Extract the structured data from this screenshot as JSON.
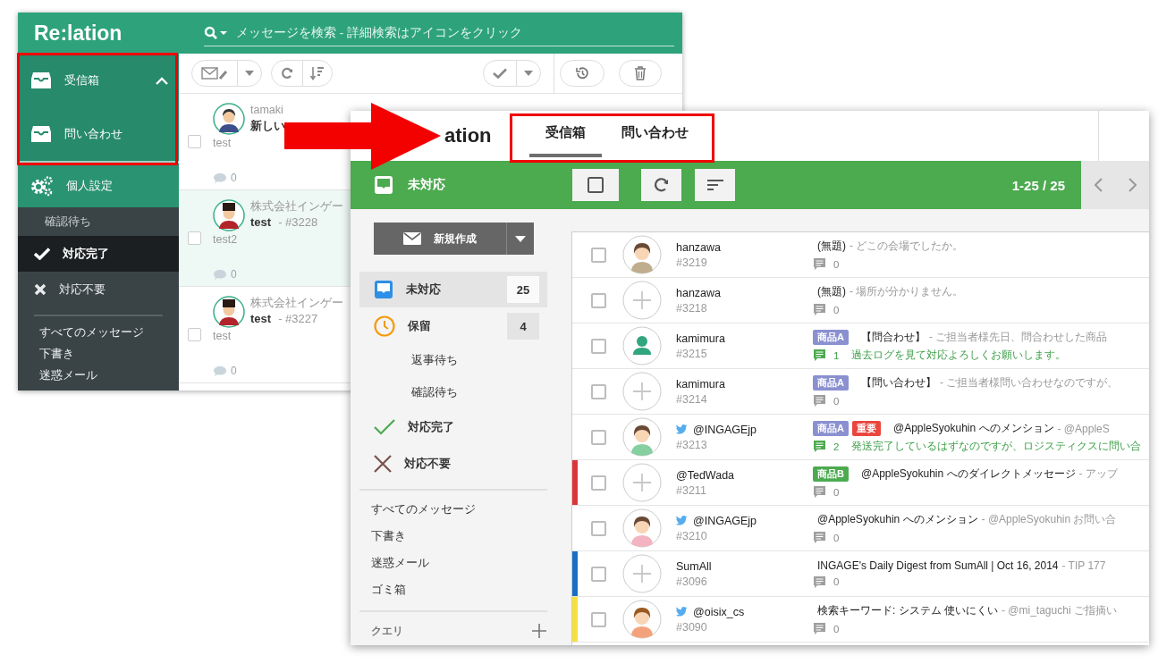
{
  "old_window": {
    "logo": "Re:lation",
    "search": {
      "placeholder": "メッセージを検索 - 詳細検索はアイコンをクリック"
    },
    "sidebar": {
      "inboxes": [
        {
          "label": "受信箱",
          "expanded": true
        },
        {
          "label": "問い合わせ"
        }
      ],
      "settings": "個人設定",
      "statuses": [
        {
          "label": "確認待ち",
          "kind": "sub",
          "selected": false
        },
        {
          "label": "対応完了",
          "kind": "done",
          "selected": true
        },
        {
          "label": "対応不要",
          "kind": "ignore",
          "selected": false
        }
      ],
      "folders": [
        "すべてのメッセージ",
        "下書き",
        "迷惑メール"
      ]
    },
    "messages": [
      {
        "sender": "tamaki",
        "subject": "新しい",
        "preview": "test",
        "comments": "0",
        "selected": false,
        "checked": false
      },
      {
        "sender": "株式会社インゲー",
        "subject": "test",
        "number": "- #3228",
        "preview": "test2",
        "comments": "0",
        "selected": true,
        "checked": false
      },
      {
        "sender": "株式会社インゲー",
        "subject": "test",
        "number": "- #3227",
        "preview": "test",
        "comments": "0",
        "selected": false,
        "checked": false
      }
    ]
  },
  "new_window": {
    "logo": "ation",
    "tabs": [
      {
        "label": "受信箱",
        "selected": true
      },
      {
        "label": "問い合わせ",
        "selected": false
      }
    ],
    "toolbar": {
      "title": "未対応",
      "range": "1-25 / 25",
      "select_all": {
        "checked": false
      }
    },
    "compose_button": "新規作成",
    "nav": [
      {
        "label": "未対応",
        "kind": "inbox",
        "count": "25",
        "selected": true
      },
      {
        "label": "保留",
        "kind": "hold",
        "count": "4",
        "selected": false
      },
      {
        "label": "返事待ち",
        "kind": "sub",
        "selected": false
      },
      {
        "label": "確認待ち",
        "kind": "sub",
        "selected": false
      },
      {
        "label": "対応完了",
        "kind": "done",
        "selected": false
      },
      {
        "label": "対応不要",
        "kind": "ignore",
        "selected": false
      }
    ],
    "folders": [
      "すべてのメッセージ",
      "下書き",
      "迷惑メール",
      "ゴミ箱"
    ],
    "query": "クエリ",
    "messages": [
      {
        "name": "hanzawa",
        "number": "#3219",
        "kind": "photo",
        "twitter": false,
        "checked": false,
        "subject": "(無題)",
        "preview": "- どこの会場でしたか。",
        "comments": "0"
      },
      {
        "name": "hanzawa",
        "number": "#3218",
        "kind": "add",
        "twitter": false,
        "checked": false,
        "subject": "(無題)",
        "preview": "- 場所が分かりません。",
        "comments": "0"
      },
      {
        "name": "kamimura",
        "number": "#3215",
        "kind": "user",
        "twitter": false,
        "checked": false,
        "tags": [
          {
            "label": "商品A",
            "color": "#8a90d0"
          }
        ],
        "subject": "【問合わせ】",
        "preview": "- ご担当者様先日、問合わせした商品",
        "comments": "1",
        "comment_text": "過去ログを見て対応よろしくお願いします。"
      },
      {
        "name": "kamimura",
        "number": "#3214",
        "kind": "add",
        "twitter": false,
        "checked": false,
        "tags": [
          {
            "label": "商品A",
            "color": "#8a90d0"
          }
        ],
        "subject": "【問い合わせ】",
        "preview": "- ご担当者様問い合わせなのですが、",
        "comments": "0"
      },
      {
        "name": "@INGAGEjp",
        "number": "#3213",
        "kind": "photo",
        "twitter": true,
        "checked": false,
        "tags": [
          {
            "label": "商品A",
            "color": "#8a90d0"
          },
          {
            "label": "重要",
            "color": "#e9463f"
          }
        ],
        "subject": "@AppleSyokuhin へのメンション",
        "preview": "- @AppleS",
        "comments": "2",
        "comment_text": "発送完了しているはずなのですが、ロジスティクスに問い合"
      },
      {
        "name": "@TedWada",
        "number": "#3211",
        "kind": "add",
        "twitter": false,
        "checked": false,
        "color": "#d9363a",
        "tags": [
          {
            "label": "商品B",
            "color": "#4caa4f"
          }
        ],
        "subject": "@AppleSyokuhin へのダイレクトメッセージ",
        "preview": "- アップ",
        "comments": "0"
      },
      {
        "name": "@INGAGEjp",
        "number": "#3210",
        "kind": "photo",
        "twitter": true,
        "checked": false,
        "subject": "@AppleSyokuhin へのメンション",
        "preview": "- @AppleSyokuhin お問い合",
        "comments": "0"
      },
      {
        "name": "SumAll",
        "number": "#3096",
        "kind": "add",
        "twitter": false,
        "checked": false,
        "color": "#1a6fc4",
        "subject": "INGAGE's Daily Digest from SumAll | Oct 16, 2014",
        "preview": "- TIP 177",
        "comments": "0"
      },
      {
        "name": "@oisix_cs",
        "number": "#3090",
        "kind": "photo",
        "twitter": true,
        "checked": false,
        "color": "#f7e03c",
        "subject": "検索キーワード: システム 使いにくい",
        "preview": "- @mi_taguchi ご指摘い",
        "comments": "0"
      }
    ]
  }
}
